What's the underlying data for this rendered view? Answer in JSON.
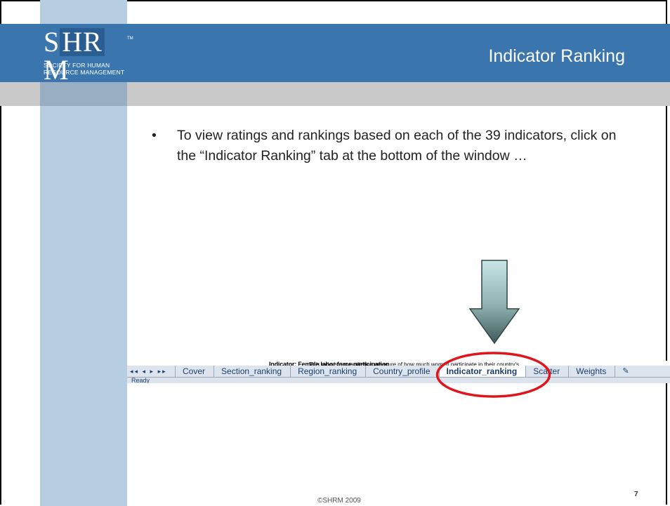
{
  "logo": {
    "mark": "SHRM",
    "tm": "TM",
    "subtitle_line1": "SOCIETY FOR HUMAN",
    "subtitle_line2": "RESOURCE MANAGEMENT"
  },
  "slide": {
    "title": "Indicator Ranking",
    "bullet_symbol": "•",
    "bullet_text": "To view ratings and rankings based on each of the 39 indicators, click on the “Indicator Ranking” tab at the bottom of the window …"
  },
  "embedded_screenshot": {
    "heading": "Indicator:   Female labor force participation",
    "note": "This ratio is a quantitative measure of how much women participate in their country's",
    "nav_controls": "◂◂ ◂ ▸ ▸▸",
    "tabs": [
      {
        "label": "Cover"
      },
      {
        "label": "Section_ranking"
      },
      {
        "label": "Region_ranking"
      },
      {
        "label": "Country_profile"
      },
      {
        "label": "Indicator_ranking"
      },
      {
        "label": "Scatter"
      },
      {
        "label": "Weights"
      }
    ],
    "insert_tab_icon": "insert-sheet-icon",
    "status": "Ready"
  },
  "colors": {
    "title_bar": "#3a76ad",
    "left_stripe": "#b6cde2",
    "highlight": "#e0141b",
    "arrow_fill_top": "#b8dcdc",
    "arrow_fill_bottom": "#4f6e6e"
  },
  "footer": {
    "copyright": "©SHRM 2009",
    "page_number": "7"
  }
}
